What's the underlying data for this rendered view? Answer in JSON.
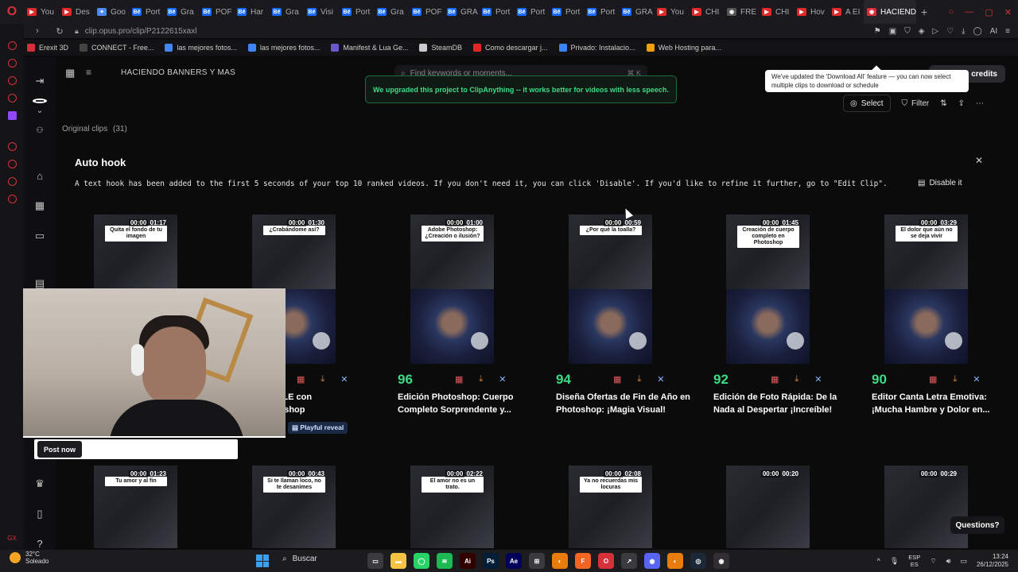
{
  "browser": {
    "tabs": [
      {
        "label": "You",
        "icon": "youtube-icon",
        "color": "#e02828",
        "letter": "▶"
      },
      {
        "label": "Des",
        "icon": "youtube-icon",
        "color": "#e02828",
        "letter": "▶"
      },
      {
        "label": "Goo",
        "icon": "gemini-icon",
        "color": "#4a8af4",
        "letter": "✦"
      },
      {
        "label": "Port",
        "icon": "behance-icon",
        "color": "#1769ff",
        "letter": "Bē"
      },
      {
        "label": "Gra",
        "icon": "behance-icon",
        "color": "#1769ff",
        "letter": "Bē"
      },
      {
        "label": "POF",
        "icon": "behance-icon",
        "color": "#1769ff",
        "letter": "Bē"
      },
      {
        "label": "Har",
        "icon": "behance-icon",
        "color": "#1769ff",
        "letter": "Bē"
      },
      {
        "label": "Gra",
        "icon": "behance-icon",
        "color": "#1769ff",
        "letter": "Bē"
      },
      {
        "label": "Visi",
        "icon": "behance-icon",
        "color": "#1769ff",
        "letter": "Bē"
      },
      {
        "label": "Port",
        "icon": "behance-icon",
        "color": "#1769ff",
        "letter": "Bē"
      },
      {
        "label": "Gra",
        "icon": "behance-icon",
        "color": "#1769ff",
        "letter": "Bē"
      },
      {
        "label": "POF",
        "icon": "behance-icon",
        "color": "#1769ff",
        "letter": "Bē"
      },
      {
        "label": "GRA",
        "icon": "behance-icon",
        "color": "#1769ff",
        "letter": "Bē"
      },
      {
        "label": "Port",
        "icon": "behance-icon",
        "color": "#1769ff",
        "letter": "Bē"
      },
      {
        "label": "Port",
        "icon": "behance-icon",
        "color": "#1769ff",
        "letter": "Bē"
      },
      {
        "label": "Port",
        "icon": "behance-icon",
        "color": "#1769ff",
        "letter": "Bē"
      },
      {
        "label": "Port",
        "icon": "behance-icon",
        "color": "#1769ff",
        "letter": "Bē"
      },
      {
        "label": "GRA",
        "icon": "behance-icon",
        "color": "#1769ff",
        "letter": "Bē"
      },
      {
        "label": "You",
        "icon": "youtube-icon",
        "color": "#e02828",
        "letter": "▶"
      },
      {
        "label": "CHI",
        "icon": "youtube-icon",
        "color": "#e02828",
        "letter": "▶"
      },
      {
        "label": "FRE",
        "icon": "generic-icon",
        "color": "#555555",
        "letter": "◉"
      },
      {
        "label": "CHI",
        "icon": "youtube-icon",
        "color": "#e02828",
        "letter": "▶"
      },
      {
        "label": "Hov",
        "icon": "youtube-icon",
        "color": "#e02828",
        "letter": "▶"
      },
      {
        "label": "A EI",
        "icon": "youtube-icon",
        "color": "#e02828",
        "letter": "▶"
      }
    ],
    "active_tab": {
      "label": "HACIEND",
      "color": "#d6303a"
    },
    "url": "clip.opus.pro/clip/P2122615xaxl",
    "bookmarks": [
      {
        "label": "Erexit 3D",
        "color": "#d6303a"
      },
      {
        "label": "CONNECT - Free...",
        "color": "#444444"
      },
      {
        "label": "las mejores fotos...",
        "color": "#4285f4"
      },
      {
        "label": "las mejores fotos...",
        "color": "#4285f4"
      },
      {
        "label": "Manifest & Lua Ge...",
        "color": "#6a5acd"
      },
      {
        "label": "SteamDB",
        "color": "#cccccc"
      },
      {
        "label": "Como descargar j...",
        "color": "#e02828"
      },
      {
        "label": "Privado: Instalacio...",
        "color": "#3b82f6"
      },
      {
        "label": "Web Hosting para...",
        "color": "#f59e0b"
      }
    ]
  },
  "app": {
    "project_title": "HACIENDO BANNERS Y MAS",
    "search_placeholder": "Find keywords or moments...",
    "search_shortcut": "⌘ K",
    "upgrade_banner": "We upgraded this project to ClipAnything -- it works better for videos with less speech.",
    "credits_label": "e credits",
    "tooltip": "We've updated the 'Download All' feature — you can now select multiple clips to download or schedule",
    "toolbar": {
      "select": "Select",
      "filter": "Filter"
    },
    "original_clips_label": "Original clips",
    "original_clips_count": "(31)",
    "autohook": {
      "title": "Auto hook",
      "text": "A text hook has been added to the first 5 seconds of your top 10 ranked videos. If you don't need it, you can click 'Disable'. If you'd like to refine it further, go to \"Edit Clip\".",
      "disable_label": "Disable it"
    },
    "clips_row1": [
      {
        "caption": "Quita el fondo de tu imagen",
        "t0": "00:00",
        "duration": "01:17",
        "score": "",
        "title": ""
      },
      {
        "caption": "¿Crabándome así?",
        "t0": "00:00",
        "duration": "01:30",
        "score": "",
        "title": "s INCREÍBLE con\ns de Photoshop"
      },
      {
        "caption": "Adobe Photoshop: ¿Creación o ilusión?",
        "t0": "00:00",
        "duration": "01:00",
        "score": "96",
        "title": "Edición Photoshop: Cuerpo Completo Sorprendente y..."
      },
      {
        "caption": "¿Por qué la toalla?",
        "t0": "00:00",
        "duration": "00:59",
        "score": "94",
        "title": "Diseña Ofertas de Fin de Año en Photoshop: ¡Magia Visual!"
      },
      {
        "caption": "Creación de cuerpo completo en Photoshop",
        "t0": "00:00",
        "duration": "01:45",
        "score": "92",
        "title": "Edición de Foto Rápida: De la Nada al Despertar ¡Increíble!"
      },
      {
        "caption": "El dolor que aún no se deja vivir",
        "t0": "00:00",
        "duration": "03:29",
        "score": "90",
        "title": "Editor Canta Letra Emotiva: ¡Mucha Hambre y Dolor en..."
      }
    ],
    "playful_label": "Playful reveal",
    "clips_row2": [
      {
        "caption": "Tu amor y al fin",
        "t0": "00:00",
        "duration": "01:23"
      },
      {
        "caption": "Si te llaman loco, no te desanimes",
        "t0": "00:00",
        "duration": "00:43"
      },
      {
        "caption": "El amor no es un trato.",
        "t0": "00:00",
        "duration": "02:22"
      },
      {
        "caption": "Ya no recuerdas mis locuras",
        "t0": "00:00",
        "duration": "02:08"
      },
      {
        "caption": "",
        "t0": "00:00",
        "duration": "00:20"
      },
      {
        "caption": "",
        "t0": "00:00",
        "duration": "00:29"
      }
    ],
    "post_now": "Post now",
    "questions": "Questions?"
  },
  "taskbar": {
    "temperature": "32°C",
    "weather": "Soleado",
    "search": "Buscar",
    "lang_top": "ESP",
    "lang_bottom": "ES",
    "time": "13:24",
    "date": "26/12/2025",
    "apps": [
      {
        "name": "task-view",
        "color": "#3a3a3f",
        "letter": "▭"
      },
      {
        "name": "file-explorer",
        "color": "#f5c542",
        "letter": "▬"
      },
      {
        "name": "whatsapp",
        "color": "#25d366",
        "letter": "◯"
      },
      {
        "name": "spotify",
        "color": "#1db954",
        "letter": "≋"
      },
      {
        "name": "illustrator",
        "color": "#330000",
        "letter": "Ai"
      },
      {
        "name": "photoshop",
        "color": "#001e36",
        "letter": "Ps"
      },
      {
        "name": "after-effects",
        "color": "#00005b",
        "letter": "Ae"
      },
      {
        "name": "store",
        "color": "#3a3a3f",
        "letter": "⊞"
      },
      {
        "name": "blender",
        "color": "#e87d0d",
        "letter": "◐"
      },
      {
        "name": "fusion",
        "color": "#f26522",
        "letter": "F"
      },
      {
        "name": "opera",
        "color": "#d6303a",
        "letter": "O"
      },
      {
        "name": "feather",
        "color": "#3a3a3f",
        "letter": "↗"
      },
      {
        "name": "discord",
        "color": "#5865f2",
        "letter": "◉"
      },
      {
        "name": "blender2",
        "color": "#e87d0d",
        "letter": "◐"
      },
      {
        "name": "steam",
        "color": "#1b2838",
        "letter": "◎"
      },
      {
        "name": "obs",
        "color": "#302e31",
        "letter": "◉"
      }
    ]
  }
}
